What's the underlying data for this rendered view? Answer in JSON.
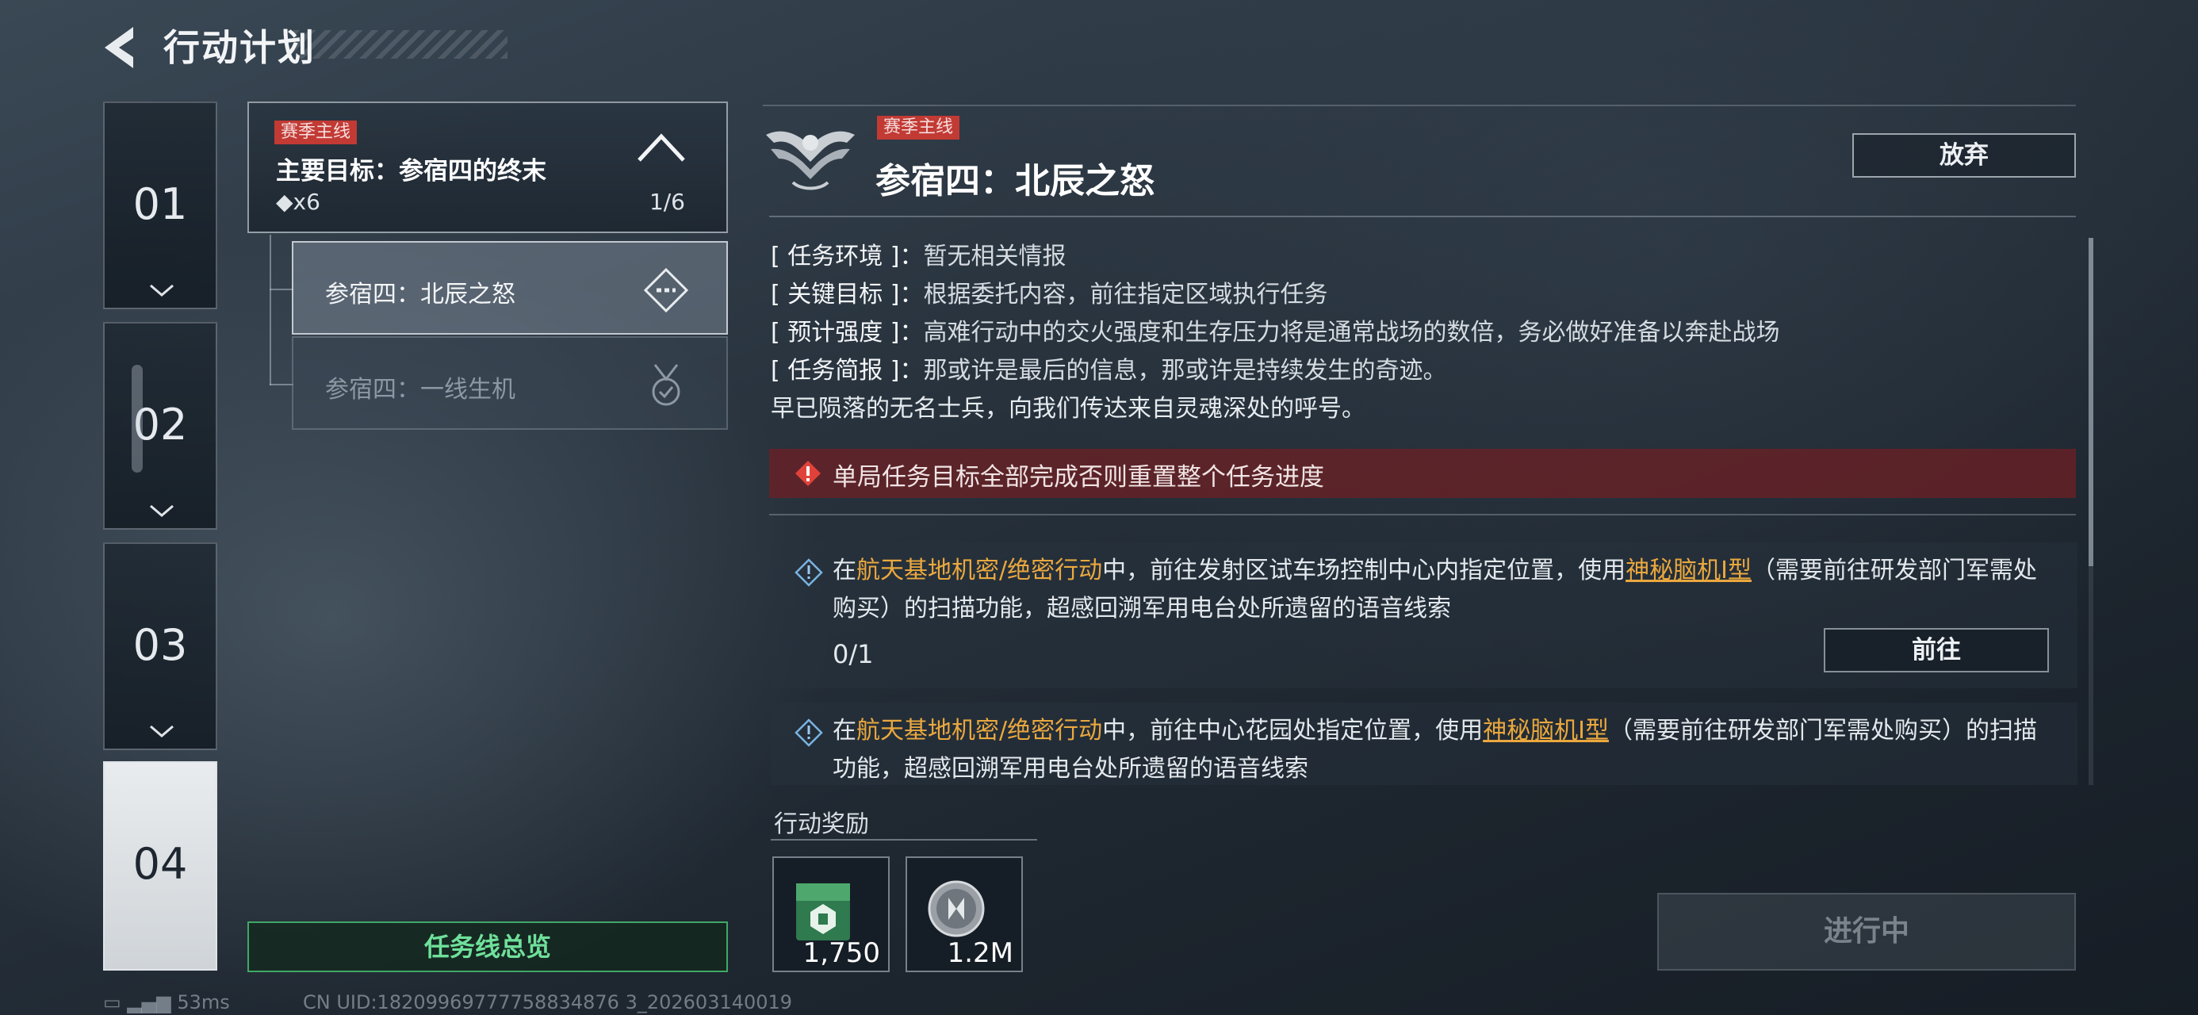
{
  "header": {
    "title": "行动计划"
  },
  "chapters": [
    {
      "label": "01"
    },
    {
      "label": "02"
    },
    {
      "label": "03"
    },
    {
      "label": "04"
    }
  ],
  "mission_list": {
    "main": {
      "tag": "赛季主线",
      "title": "主要目标：参宿四的终末",
      "reward": "◆x6",
      "progress": "1/6"
    },
    "subs": [
      {
        "label": "参宿四：北辰之怒"
      },
      {
        "label": "参宿四：一线生机"
      }
    ],
    "overview_label": "任务线总览"
  },
  "detail": {
    "tag": "赛季主线",
    "title": "参宿四：北辰之怒",
    "abandon_label": "放弃",
    "info": [
      {
        "key": "[ 任务环境 ]：",
        "value": "暂无相关情报"
      },
      {
        "key": "[ 关键目标 ]：",
        "value": "根据委托内容，前往指定区域执行任务"
      },
      {
        "key": "[ 预计强度 ]：",
        "value": "高难行动中的交火强度和生存压力将是通常战场的数倍，务必做好准备以奔赴战场"
      },
      {
        "key": "[ 任务简报 ]：",
        "value": "那或许是最后的信息，那或许是持续发生的奇迹。"
      }
    ],
    "briefing_extra": "早已陨落的无名士兵，向我们传达来自灵魂深处的呼号。",
    "warning": "单局任务目标全部完成否则重置整个任务进度",
    "tasks": [
      {
        "t1": "在",
        "h1": "航天基地机密/绝密行动",
        "t2": "中，前往发射区试车场控制中心内指定位置，使用",
        "link": "神秘脑机Ⅰ型",
        "t3": "（需要前往研发部门军需处购买）的扫描功能，超感回溯军用电台处所遗留的语音线索",
        "progress": "0/1",
        "goto_label": "前往"
      },
      {
        "t1": "在",
        "h1": "航天基地机密/绝密行动",
        "t2": "中，前往中心花园处指定位置，使用",
        "link": "神秘脑机Ⅰ型",
        "t3": "（需要前往研发部门军需处购买）的扫描功能，超感回溯军用电台处所遗留的语音线索"
      }
    ],
    "rewards_label": "行动奖励",
    "rewards": [
      {
        "icon": "supply-crate-icon",
        "amount": "1,750"
      },
      {
        "icon": "silver-coin-icon",
        "amount": "1.2M"
      }
    ],
    "status_button": "进行中"
  },
  "status": {
    "ping": "53ms",
    "uid": "CN UID:18209969777758834876 3_202603140019"
  },
  "colors": {
    "accent_red": "#c23a34",
    "highlight_orange": "#eaa83e",
    "overview_green": "#6fe09a"
  }
}
